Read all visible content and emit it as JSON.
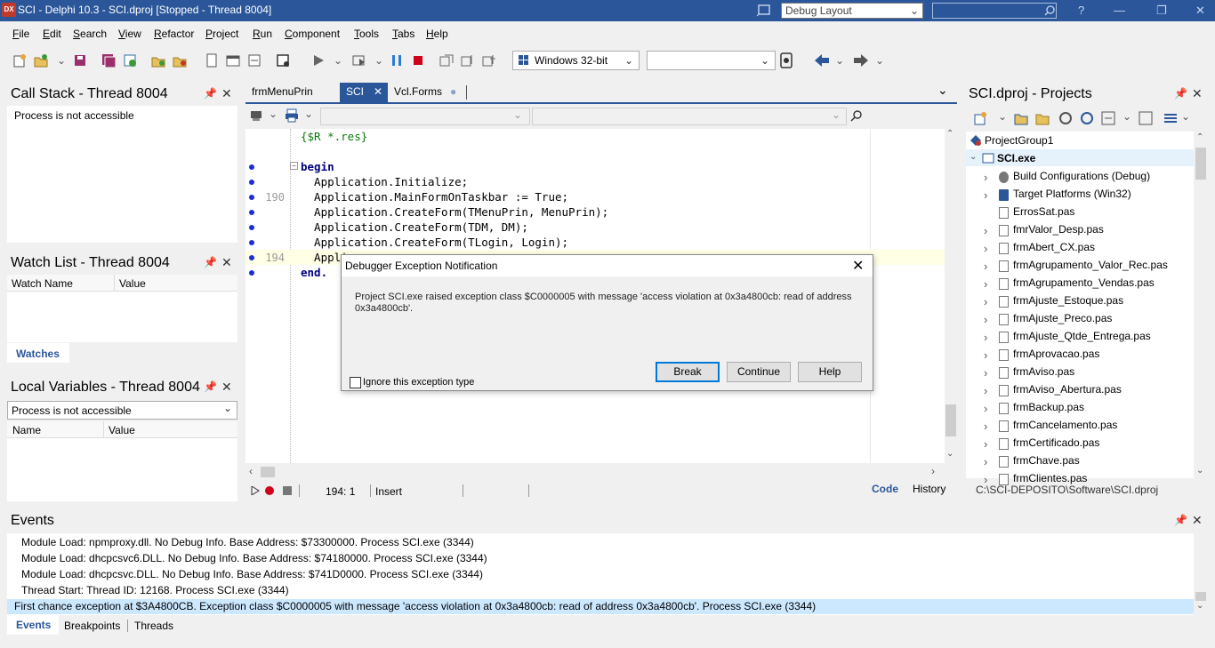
{
  "window": {
    "title": "SCI - Delphi 10.3 - SCI.dproj [Stopped - Thread 8004]",
    "logo": "DX",
    "layout_combo": "Debug Layout",
    "help_icon": "?"
  },
  "menu": [
    "File",
    "Edit",
    "Search",
    "View",
    "Refactor",
    "Project",
    "Run",
    "Component",
    "Tools",
    "Tabs",
    "Help"
  ],
  "toolbar": {
    "platform": "Windows 32-bit",
    "config": ""
  },
  "call_stack": {
    "title": "Call Stack - Thread 8004",
    "message": "Process is not accessible"
  },
  "watch_list": {
    "title": "Watch List - Thread 8004",
    "col_name": "Watch Name",
    "col_value": "Value",
    "tab": "Watches"
  },
  "local_vars": {
    "title": "Local Variables - Thread 8004",
    "combo": "Process is not accessible",
    "col_name": "Name",
    "col_value": "Value"
  },
  "editor": {
    "tabs": [
      "frmMenuPrin",
      "SCI",
      "Vcl.Forms"
    ],
    "lines": [
      {
        "n": "",
        "t": "{$R *.res}",
        "bp": false
      },
      {
        "n": "",
        "t": "",
        "bp": false
      },
      {
        "n": "",
        "t": "begin",
        "bp": true
      },
      {
        "n": "",
        "t": "  Application.Initialize;",
        "bp": true
      },
      {
        "n": "190",
        "t": "  Application.MainFormOnTaskbar := True;",
        "bp": true
      },
      {
        "n": "",
        "t": "  Application.CreateForm(TMenuPrin, MenuPrin);",
        "bp": true
      },
      {
        "n": "",
        "t": "  Application.CreateForm(TDM, DM);",
        "bp": true
      },
      {
        "n": "",
        "t": "  Application.CreateForm(TLogin, Login);",
        "bp": true
      },
      {
        "n": "194",
        "t": "  Appli",
        "bp": true
      },
      {
        "n": "",
        "t": "end.",
        "bp": true
      }
    ],
    "status": {
      "position": "194:  1",
      "mode": "Insert",
      "tab_code": "Code",
      "tab_history": "History"
    }
  },
  "dialog": {
    "title": "Debugger Exception Notification",
    "message": "Project SCI.exe raised exception class $C0000005 with message 'access violation at 0x3a4800cb: read of address 0x3a4800cb'.",
    "checkbox": "Ignore this exception type",
    "break": "Break",
    "continue": "Continue",
    "help": "Help"
  },
  "projects": {
    "title": "SCI.dproj - Projects",
    "group": "ProjectGroup1",
    "project": "SCI.exe",
    "items": [
      "Build Configurations (Debug)",
      "Target Platforms (Win32)",
      "ErrosSat.pas",
      "fmrValor_Desp.pas",
      "frmAbert_CX.pas",
      "frmAgrupamento_Valor_Rec.pas",
      "frmAgrupamento_Vendas.pas",
      "frmAjuste_Estoque.pas",
      "frmAjuste_Preco.pas",
      "frmAjuste_Qtde_Entrega.pas",
      "frmAprovacao.pas",
      "frmAviso.pas",
      "frmAviso_Abertura.pas",
      "frmBackup.pas",
      "frmCancelamento.pas",
      "frmCertificado.pas",
      "frmChave.pas",
      "frmClientes.pas"
    ],
    "path": "C:\\SCI-DEPOSITO\\Software\\SCI.dproj"
  },
  "events": {
    "title": "Events",
    "lines": [
      "Module Load: npmproxy.dll. No Debug Info. Base Address: $73300000. Process SCI.exe (3344)",
      "Module Load: dhcpcsvc6.DLL. No Debug Info. Base Address: $74180000. Process SCI.exe (3344)",
      "Module Load: dhcpcsvc.DLL. No Debug Info. Base Address: $741D0000. Process SCI.exe (3344)",
      "Thread Start: Thread ID: 12168. Process SCI.exe (3344)",
      "First chance exception at $3A4800CB. Exception class $C0000005 with message 'access violation at 0x3a4800cb: read of address 0x3a4800cb'. Process SCI.exe (3344)"
    ],
    "tabs": [
      "Events",
      "Breakpoints",
      "Threads"
    ]
  }
}
